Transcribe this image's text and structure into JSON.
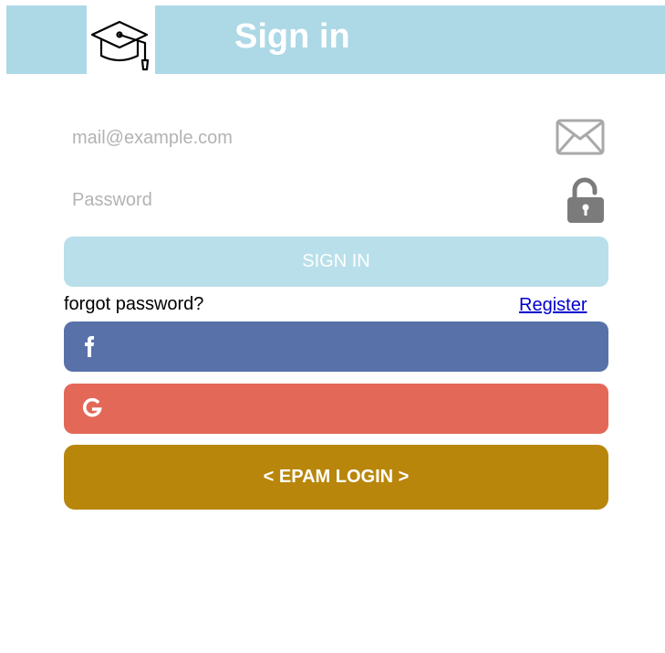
{
  "header": {
    "title": "Sign in",
    "logo_icon": "graduation-cap-icon",
    "background_color": "#add8e6"
  },
  "form": {
    "email": {
      "placeholder": "mail@example.com",
      "value": "",
      "icon": "envelope-icon"
    },
    "password": {
      "placeholder": "Password",
      "value": "",
      "icon": "unlocked-padlock-icon"
    },
    "sign_in_label": "SIGN IN",
    "sign_in_color": "#b9dfea",
    "forgot_label": "forgot password?",
    "register_label": "Register"
  },
  "social": {
    "facebook": {
      "icon": "facebook-icon",
      "color": "#5872a9"
    },
    "google": {
      "icon": "google-icon",
      "color": "#e36858"
    },
    "epam": {
      "label": "< EPAM LOGIN >",
      "color": "#b8860b"
    }
  }
}
